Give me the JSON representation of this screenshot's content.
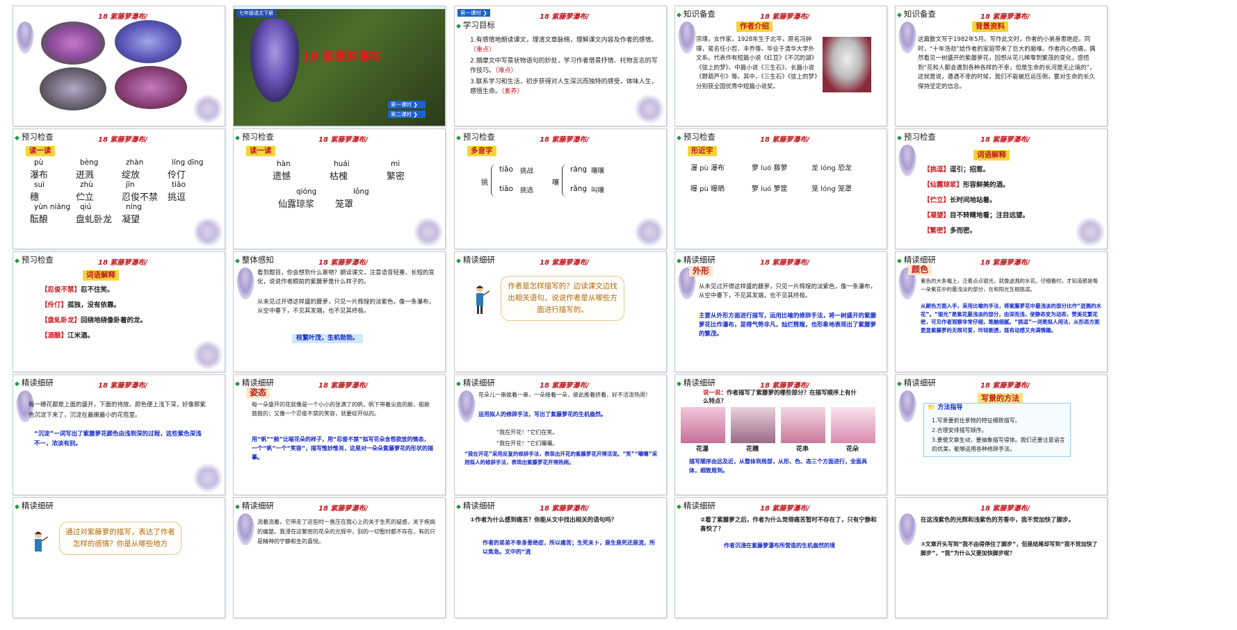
{
  "header": "18 紫藤萝瀑布/",
  "slides": [
    {
      "n": "1"
    },
    {
      "n": "2",
      "tag": "七年级语文下册",
      "title": "18 紫藤萝瀑布",
      "btn1": "第一课时",
      "btn2": "第二课时"
    },
    {
      "n": "3",
      "btn": "第一课时",
      "kw": "学习目标",
      "g1": "1.有感情地朗读课文，理清文章脉络，理解课文内容及作者的感情。",
      "g1k": "（重点）",
      "g2": "2.揣摩文中写景状物语句的妙处，学习作者借景抒情、托物言志的写作技巧。",
      "g2k": "（难点）",
      "g3": "3.联系学习和生活，初步获得对人生深沉而独特的感受，体味人生，感悟生命。",
      "g3k": "（素养）"
    },
    {
      "n": "4",
      "kw": "知识备查",
      "sub": "作者介绍",
      "text": "宗璞，女作家，1928年生于北平，原名冯钟璞，笔名任小哲、丰乔等。毕业于清华大学外文系。代表作有短篇小说《红豆》《不沉的湖》《弦上的梦》、中篇小说《三生石》、长篇小说《野葫芦引》等。其中，《三生石》《弦上的梦》分别获全国优秀中短篇小说奖。"
    },
    {
      "n": "5",
      "kw": "知识备查",
      "sub": "背景资料",
      "text": "这篇散文写于1982年5月。写作此文时，作者的小弟身患绝症。同时，“十年浩劫”给作者的家庭带来了巨大的磨难。作者内心伤痛，偶然看见一树盛开的紫藤萝花，回想从花儿稀零到繁茂的变化，感悟到“花和人都会遇到各种各样的不幸，但是生命的长河是无止境的”，这就是说，遭遇不幸的时候，我们不能被厄运压倒，要对生命的长久保持坚定的信念。"
    },
    {
      "n": "6",
      "kw": "预习检查",
      "sub": "读一读",
      "items": [
        {
          "py": "pù",
          "w": "瀑布"
        },
        {
          "py": "bèng",
          "w": "迸溅"
        },
        {
          "py": "zhàn",
          "w": "绽放"
        },
        {
          "py": "líng dīng",
          "w": "伶仃"
        },
        {
          "py": "suì",
          "w": "穗"
        },
        {
          "py": "zhù",
          "w": "伫立"
        },
        {
          "py": "jīn",
          "w": "忍俊不禁"
        },
        {
          "py": "tiāo",
          "w": "挑逗"
        },
        {
          "py": "yùn niàng",
          "w": "酝酿"
        },
        {
          "py": "qiú",
          "w": "盘虬卧龙"
        },
        {
          "py": "níng",
          "w": "凝望"
        }
      ]
    },
    {
      "n": "7",
      "kw": "预习检查",
      "sub": "读一读",
      "items": [
        {
          "py": "hàn",
          "w": "遗憾"
        },
        {
          "py": "huái",
          "w": "枯槐"
        },
        {
          "py": "mì",
          "w": "繁密"
        },
        {
          "py": "qióng",
          "w": "仙露琼浆"
        },
        {
          "py": "lǒng",
          "w": "笼罩"
        }
      ]
    },
    {
      "n": "8",
      "kw": "预习检查",
      "sub": "多音字",
      "left": "挑",
      "l1py": "tiǎo",
      "l1w": "挑战",
      "l2py": "tiāo",
      "l2w": "挑选",
      "mid": "嚷",
      "m1py": "rāng",
      "m1w": "嚷嚷",
      "m2py": "rǎng",
      "m2w": "叫嚷"
    },
    {
      "n": "9",
      "kw": "预习检查",
      "sub": "形近字",
      "a1": "瀑 pù 瀑布",
      "a2": "曝 pù 曝晒",
      "b1": "萝 luó 藤萝",
      "b2": "箩 luó 箩筐",
      "c1": "龙 lóng 恐龙",
      "c2": "笼 lóng 笼罩"
    },
    {
      "n": "10",
      "kw": "预习检查",
      "sub": "词语解释",
      "defs": [
        {
          "k": "【挑逗】",
          "v": "逗引；招惹。"
        },
        {
          "k": "【仙露琼浆】",
          "v": "形容鲜美的酒。"
        },
        {
          "k": "【伫立】",
          "v": "长时间地站着。"
        },
        {
          "k": "【凝望】",
          "v": "目不转睛地看；注目远望。"
        },
        {
          "k": "【繁密】",
          "v": "多而密。"
        }
      ]
    },
    {
      "n": "11",
      "kw": "预习检查",
      "sub": "词语解释",
      "defs": [
        {
          "k": "【忍俊不禁】",
          "v": "忍不住笑。"
        },
        {
          "k": "【伶仃】",
          "v": "孤独，没有依靠。"
        },
        {
          "k": "【盘虬卧龙】",
          "v": "回绕地绕像卧着的龙。"
        },
        {
          "k": "【酒酿】",
          "v": "江米酒。"
        }
      ]
    },
    {
      "n": "12",
      "kw": "整体感知",
      "q": "看到题目，你会想到什么景物？朗读课文，注意语音轻重、长短的变化，说说作者眼前的紫藤萝是什么样子的。",
      "p": "从未见过开得这样盛的藤萝，只见一片辉煌的淡紫色，像一条瀑布，从空中垂下，不见其发端，也不见其终极。",
      "ans": "枝繁叶茂，生机勃勃。"
    },
    {
      "n": "13",
      "kw": "精读细研",
      "bubble": "作者是怎样描写的？边读课文边找出相关语句，说说作者是从哪些方面进行描写的。"
    },
    {
      "n": "14",
      "kw": "精读细研",
      "sub": "外形",
      "p": "从未见过开得这样盛的藤萝，只见一片辉煌的淡紫色，像一条瀑布，从空中垂下，不见其发端，也不见其终极。",
      "ans": "主要从外形方面进行描写，运用比喻的修辞手法，将一树盛开的紫藤萝花比作瀑布，显得气势非凡，灿烂辉煌，也形象地表现出了紫藤萝的繁茂。"
    },
    {
      "n": "15",
      "kw": "精读细研",
      "sub": "颜色",
      "p": "紫色的大条幅上，泛着点点银光，就像迸溅的水花。仔细看时，才知道那是每一朵紫花中的最浅淡的部分，在和阳光互相挑逗。",
      "ans": "从颜色方面入手，采用比喻的手法，将紫藤萝花中最浅淡的部分比作“迸溅的水花”。“银光”是紫花最浅淡的部分，由深而浅，使静态变为动态，赞美花繁花密，可见作者观察非常仔细，笔触细腻。“挑逗”一词是拟人用法，从形态方面更显紫藤萝的无限可爱，玲珑剔透，既有动感又充满情趣。"
    },
    {
      "n": "16",
      "kw": "精读细研",
      "p": "每一穗花都是上面的盛开，下面的待放。颜色便上浅下深，好像那紫色沉淀下来了，沉淀在最嫩最小的花苞里。",
      "ans": "“沉淀”一词写出了紫藤萝花颜色由浅到深的过程，这些紫色深浅不一，浓淡有别。"
    },
    {
      "n": "17",
      "kw": "精读细研",
      "sub": "姿态",
      "p": "每一朵盛开的花就像是一个小小的张满了的帆，帆下带着尖底的舱，船舱鼓鼓的；又像一个忍俊不禁的笑容，就要绽开似的。",
      "ans": "用“帆”“舱”比喻花朵的样子，用“忍俊不禁”拟写花朵含苞欲放的情态，一个“帆”一个“笑容”，描写惟妙惟肖，这是对一朵朵紫藤萝花的形状的描摹。"
    },
    {
      "n": "18",
      "kw": "精读细研",
      "p": "花朵儿一串挨着一串，一朵接着一朵，彼此推着挤着，好不活泼热闹！",
      "ans": "运用拟人的修辞手法，写出了紫藤萝花的生机盎然。",
      "q1": "“我在开花！”它们在笑。",
      "q2": "“我在开花！”它们嚷嚷。",
      "ans2": "“我在开花”采用反复的修辞手法，表现出开花的紫藤萝花开得活泼。“笑”“嚷嚷”采用拟人的修辞手法，表现出紫藤萝花开得热闹。"
    },
    {
      "n": "19",
      "kw": "精读细研",
      "say": "说一说",
      "q": "作者描写了紫藤萝的哪些部分？在描写顺序上有什么特点？",
      "labels": [
        "花瀑",
        "花穗",
        "花串",
        "花朵"
      ],
      "ans": "描写顺序由远及近，从整体到局部，从形、色、态三个方面进行，全面具体，细致周到。"
    },
    {
      "n": "20",
      "kw": "精读细研",
      "sub": "写景的方法",
      "guide": "方法指导",
      "m": [
        "1.写景要抓住景物的特征细致描写。",
        "2.合理安排描写顺序。",
        "3.要使文章生动，要抽象描写得体。我们还要注意语言的优美，能够运用各种修辞手法。"
      ]
    },
    {
      "n": "",
      "kw": "精读细研",
      "bubble": "通过对紫藤萝的描写，表达了作者怎样的感情？你是从哪些地方"
    },
    {
      "n": "",
      "kw": "精读细研",
      "p": "流着流着，它带走了这些时一直压在我心上的关于生死的疑惑，关于疾病的痛楚。我浸在这繁密的花朵的光辉中，别的一切暂时都不存在，有的只是精神的宁静和生的喜悦。"
    },
    {
      "n": "",
      "kw": "精读细研",
      "q": "①作者为什么感到痛苦？你能从文中找出相关的语句吗？",
      "a": "作者的弟弟不幸身患绝症，所以痛苦；生死未卜，是生是死还是流，所以焦急。文中的“流"
    },
    {
      "n": "",
      "kw": "精读细研",
      "q": "②看了紫藤萝之后，作者为什么觉得痛苦暂时不存在了，只有宁静和喜悦了？",
      "a": "作者沉浸在紫藤萝瀑布所营造的生机盎然的境"
    },
    {
      "n": "",
      "kw": "",
      "p": "在这浅紫色的光辉和浅紫色的芳香中，我不觉加快了脚步。",
      "q": "③文章开头写到“我不由得停住了脚步”，但是结尾却写到“我不觉加快了脚步”，“我”为什么又要加快脚步呢？"
    }
  ]
}
